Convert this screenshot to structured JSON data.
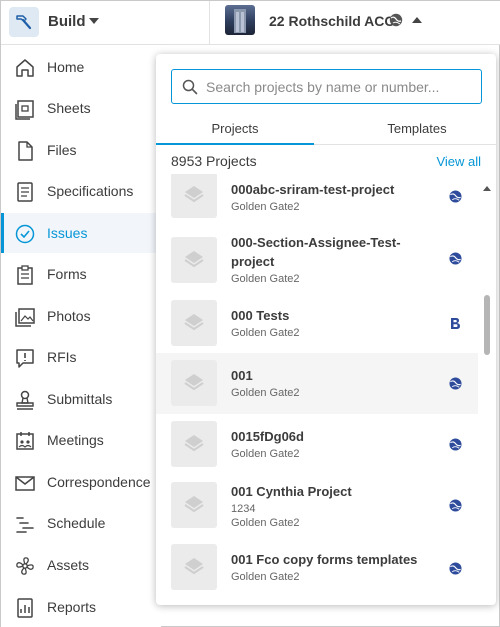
{
  "topbar": {
    "module_label": "Build",
    "project_name": "22 Rothschild ACC"
  },
  "sidebar": {
    "items": [
      {
        "label": "Home",
        "icon": "home-icon",
        "active": false
      },
      {
        "label": "Sheets",
        "icon": "sheets-icon",
        "active": false
      },
      {
        "label": "Files",
        "icon": "files-icon",
        "active": false
      },
      {
        "label": "Specifications",
        "icon": "specifications-icon",
        "active": false
      },
      {
        "label": "Issues",
        "icon": "issues-icon",
        "active": true
      },
      {
        "label": "Forms",
        "icon": "forms-icon",
        "active": false
      },
      {
        "label": "Photos",
        "icon": "photos-icon",
        "active": false
      },
      {
        "label": "RFIs",
        "icon": "rfis-icon",
        "active": false
      },
      {
        "label": "Submittals",
        "icon": "submittals-icon",
        "active": false
      },
      {
        "label": "Meetings",
        "icon": "meetings-icon",
        "active": false
      },
      {
        "label": "Correspondence",
        "icon": "correspondence-icon",
        "active": false
      },
      {
        "label": "Schedule",
        "icon": "schedule-icon",
        "active": false
      },
      {
        "label": "Assets",
        "icon": "assets-icon",
        "active": false
      },
      {
        "label": "Reports",
        "icon": "reports-icon",
        "active": false
      }
    ]
  },
  "dropdown": {
    "search": {
      "placeholder": "Search projects by name or number...",
      "value": ""
    },
    "tabs": [
      {
        "label": "Projects",
        "active": true
      },
      {
        "label": "Templates",
        "active": false
      }
    ],
    "project_count": "8953 Projects",
    "view_all_label": "View all",
    "projects": [
      {
        "name": "000abc-sriram-test-project",
        "number": "",
        "account": "Golden Gate2",
        "type_icon": "acc-globe-icon"
      },
      {
        "name": "000-Section-Assignee-Test-project",
        "number": "",
        "account": "Golden Gate2",
        "type_icon": "acc-globe-icon"
      },
      {
        "name": "000 Tests",
        "number": "",
        "account": "Golden Gate2",
        "type_icon": "bim360-b-icon"
      },
      {
        "name": "001",
        "number": "",
        "account": "Golden Gate2",
        "type_icon": "acc-globe-icon"
      },
      {
        "name": "0015fDg06d",
        "number": "",
        "account": "Golden Gate2",
        "type_icon": "acc-globe-icon"
      },
      {
        "name": "001 Cynthia Project",
        "number": "1234",
        "account": "Golden Gate2",
        "type_icon": "acc-globe-icon"
      },
      {
        "name": "001 Fco copy forms templates",
        "number": "",
        "account": "Golden Gate2",
        "type_icon": "acc-globe-icon"
      }
    ]
  },
  "colors": {
    "accent": "#0696d7",
    "globe": "#2f4c9c",
    "text": "#3c3c3c"
  }
}
